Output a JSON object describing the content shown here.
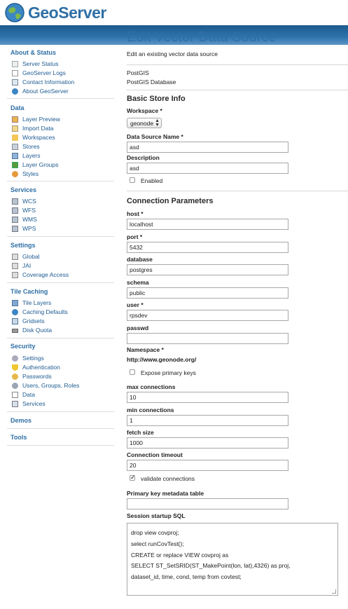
{
  "app": {
    "logo_text": "GeoServer",
    "brand_color": "#2f6fa5",
    "header_bar_color": "#2d73ad"
  },
  "sidebar": {
    "groups": [
      {
        "title": "About & Status",
        "items": [
          {
            "label": "Server Status",
            "icon": "server-status-icon"
          },
          {
            "label": "GeoServer Logs",
            "icon": "logs-icon"
          },
          {
            "label": "Contact Information",
            "icon": "contact-icon"
          },
          {
            "label": "About GeoServer",
            "icon": "about-icon"
          }
        ]
      },
      {
        "title": "Data",
        "items": [
          {
            "label": "Layer Preview",
            "icon": "layer-preview-icon"
          },
          {
            "label": "Import Data",
            "icon": "import-icon"
          },
          {
            "label": "Workspaces",
            "icon": "folder-icon"
          },
          {
            "label": "Stores",
            "icon": "stores-icon"
          },
          {
            "label": "Layers",
            "icon": "layers-icon"
          },
          {
            "label": "Layer Groups",
            "icon": "layer-groups-icon"
          },
          {
            "label": "Styles",
            "icon": "styles-icon"
          }
        ]
      },
      {
        "title": "Services",
        "items": [
          {
            "label": "WCS",
            "icon": "wcs-icon"
          },
          {
            "label": "WFS",
            "icon": "wfs-icon"
          },
          {
            "label": "WMS",
            "icon": "wms-icon"
          },
          {
            "label": "WPS",
            "icon": "wps-icon"
          }
        ]
      },
      {
        "title": "Settings",
        "items": [
          {
            "label": "Global",
            "icon": "global-icon"
          },
          {
            "label": "JAI",
            "icon": "jai-icon"
          },
          {
            "label": "Coverage Access",
            "icon": "coverage-icon"
          }
        ]
      },
      {
        "title": "Tile Caching",
        "items": [
          {
            "label": "Tile Layers",
            "icon": "tile-layers-icon"
          },
          {
            "label": "Caching Defaults",
            "icon": "caching-icon"
          },
          {
            "label": "Gridsets",
            "icon": "gridsets-icon"
          },
          {
            "label": "Disk Quota",
            "icon": "disk-icon"
          }
        ]
      },
      {
        "title": "Security",
        "items": [
          {
            "label": "Settings",
            "icon": "wrench-icon"
          },
          {
            "label": "Authentication",
            "icon": "shield-icon"
          },
          {
            "label": "Passwords",
            "icon": "key-icon"
          },
          {
            "label": "Users, Groups, Roles",
            "icon": "users-icon"
          },
          {
            "label": "Data",
            "icon": "data-icon"
          },
          {
            "label": "Services",
            "icon": "services-icon"
          }
        ]
      },
      {
        "title": "Demos",
        "items": []
      },
      {
        "title": "Tools",
        "items": []
      }
    ]
  },
  "main": {
    "title": "Edit Vector Data Source",
    "description": "Edit an existing vector data source",
    "store_type": "PostGIS",
    "store_type_desc": "PostGIS Database",
    "basic_info_title": "Basic Store Info",
    "workspace_label": "Workspace *",
    "workspace_value": "geonode",
    "name_label": "Data Source Name *",
    "name_value": "asd",
    "description_label": "Description",
    "description_value": "asd",
    "enabled_label": "Enabled",
    "enabled_checked": false,
    "conn_title": "Connection Parameters",
    "host_label": "host *",
    "host_value": "localhost",
    "port_label": "port *",
    "port_value": "5432",
    "database_label": "database",
    "database_value": "postgres",
    "schema_label": "schema",
    "schema_value": "public",
    "user_label": "user *",
    "user_value": "rpsdev",
    "passwd_label": "passwd",
    "passwd_value": "",
    "namespace_label": "Namespace *",
    "namespace_value": "http://www.geonode.org/",
    "expose_pk_label": "Expose primary keys",
    "expose_pk_checked": false,
    "max_conn_label": "max connections",
    "max_conn_value": "10",
    "min_conn_label": "min connections",
    "min_conn_value": "1",
    "fetch_label": "fetch size",
    "fetch_value": "1000",
    "timeout_label": "Connection timeout",
    "timeout_value": "20",
    "validate_label": "validate connections",
    "validate_checked": true,
    "pk_table_label": "Primary key metadata table",
    "pk_table_value": "",
    "sql_label": "Session startup SQL",
    "sql_lines": [
      "drop view covproj;",
      "select runCovTest();",
      "CREATE or replace VIEW covproj as",
      "SELECT ST_SetSRID(ST_MakePoint(lon, lat),4326) as proj,",
      "dataset_id, time, cond, temp from covtest;"
    ]
  }
}
